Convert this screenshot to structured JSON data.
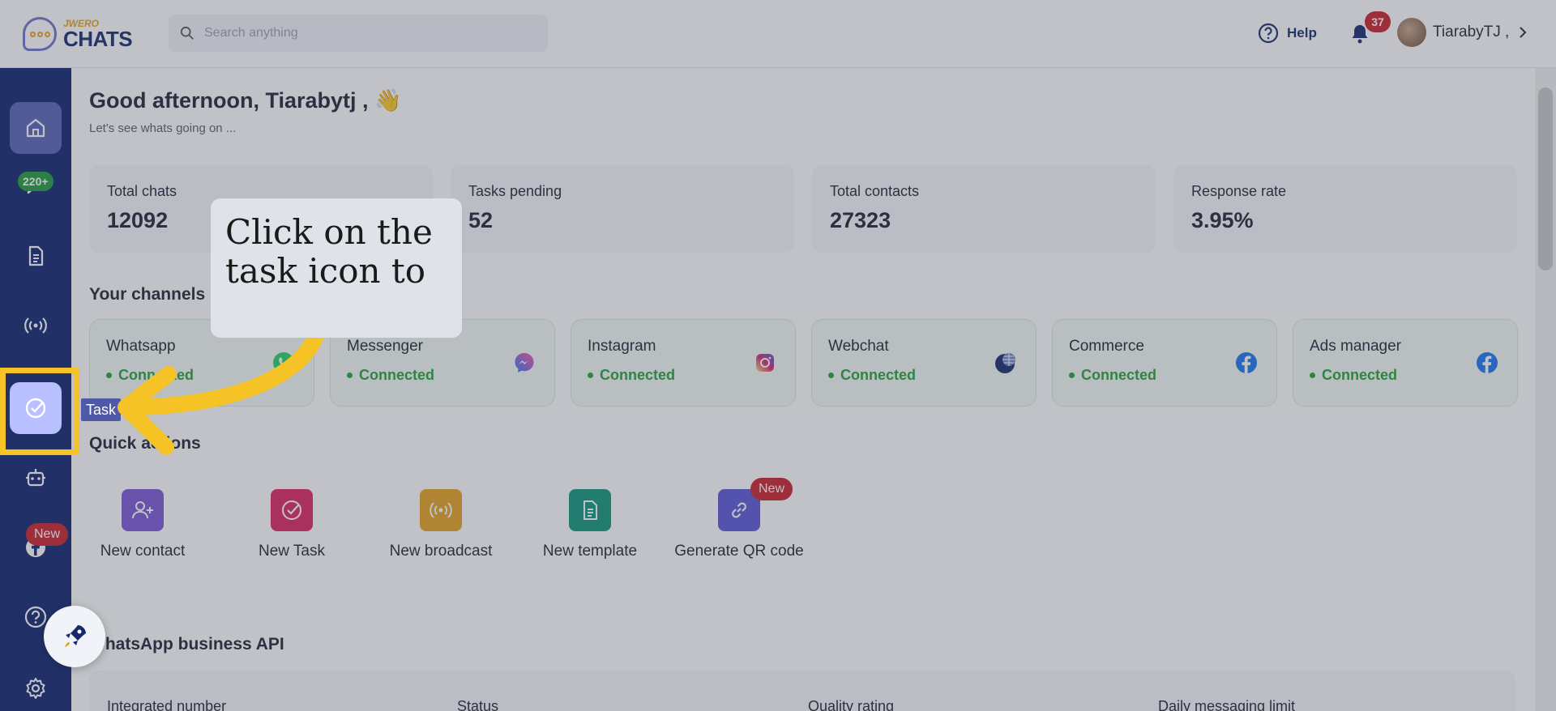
{
  "header": {
    "logo_small": "JWERO",
    "logo_big": "CHATS",
    "search_placeholder": "Search anything",
    "help_label": "Help",
    "notification_count": "37",
    "user_name": "TiarabyTJ ,"
  },
  "sidebar": {
    "chats_badge": "220+",
    "facebook_badge": "New",
    "task_tooltip": "Task"
  },
  "main": {
    "greeting": "Good afternoon, Tiarabytj , 👋",
    "subtitle": "Let's see whats going on ...",
    "stats": [
      {
        "label": "Total chats",
        "value": "12092"
      },
      {
        "label": "Tasks pending",
        "value": "52"
      },
      {
        "label": "Total contacts",
        "value": "27323"
      },
      {
        "label": "Response rate",
        "value": "3.95%"
      }
    ],
    "channels_title": "Your channels",
    "channels": [
      {
        "name": "Whatsapp",
        "status": "Connected",
        "icon": "whatsapp-icon"
      },
      {
        "name": "Messenger",
        "status": "Connected",
        "icon": "messenger-icon"
      },
      {
        "name": "Instagram",
        "status": "Connected",
        "icon": "instagram-icon"
      },
      {
        "name": "Webchat",
        "status": "Connected",
        "icon": "webchat-icon"
      },
      {
        "name": "Commerce",
        "status": "Connected",
        "icon": "facebook-icon"
      },
      {
        "name": "Ads manager",
        "status": "Connected",
        "icon": "facebook-icon"
      }
    ],
    "quick_actions_title": "Quick actions",
    "quick_actions": [
      {
        "label": "New contact",
        "color": "#7b56d6"
      },
      {
        "label": "New Task",
        "color": "#e0245e"
      },
      {
        "label": "New broadcast",
        "color": "#e6a321"
      },
      {
        "label": "New template",
        "color": "#11957b"
      },
      {
        "label": "Generate QR code",
        "color": "#5a55d6",
        "badge": "New"
      }
    ],
    "api_title": "WhatsApp business API",
    "api_columns": [
      "Integrated number",
      "Status",
      "Quality rating",
      "Daily messaging limit"
    ]
  },
  "callout": {
    "text": "Click on the task icon to"
  },
  "colors": {
    "sidebar": "#0f2470",
    "accent_yellow": "#f5c326",
    "connected_green": "#23a03a",
    "badge_red": "#c8202a"
  }
}
